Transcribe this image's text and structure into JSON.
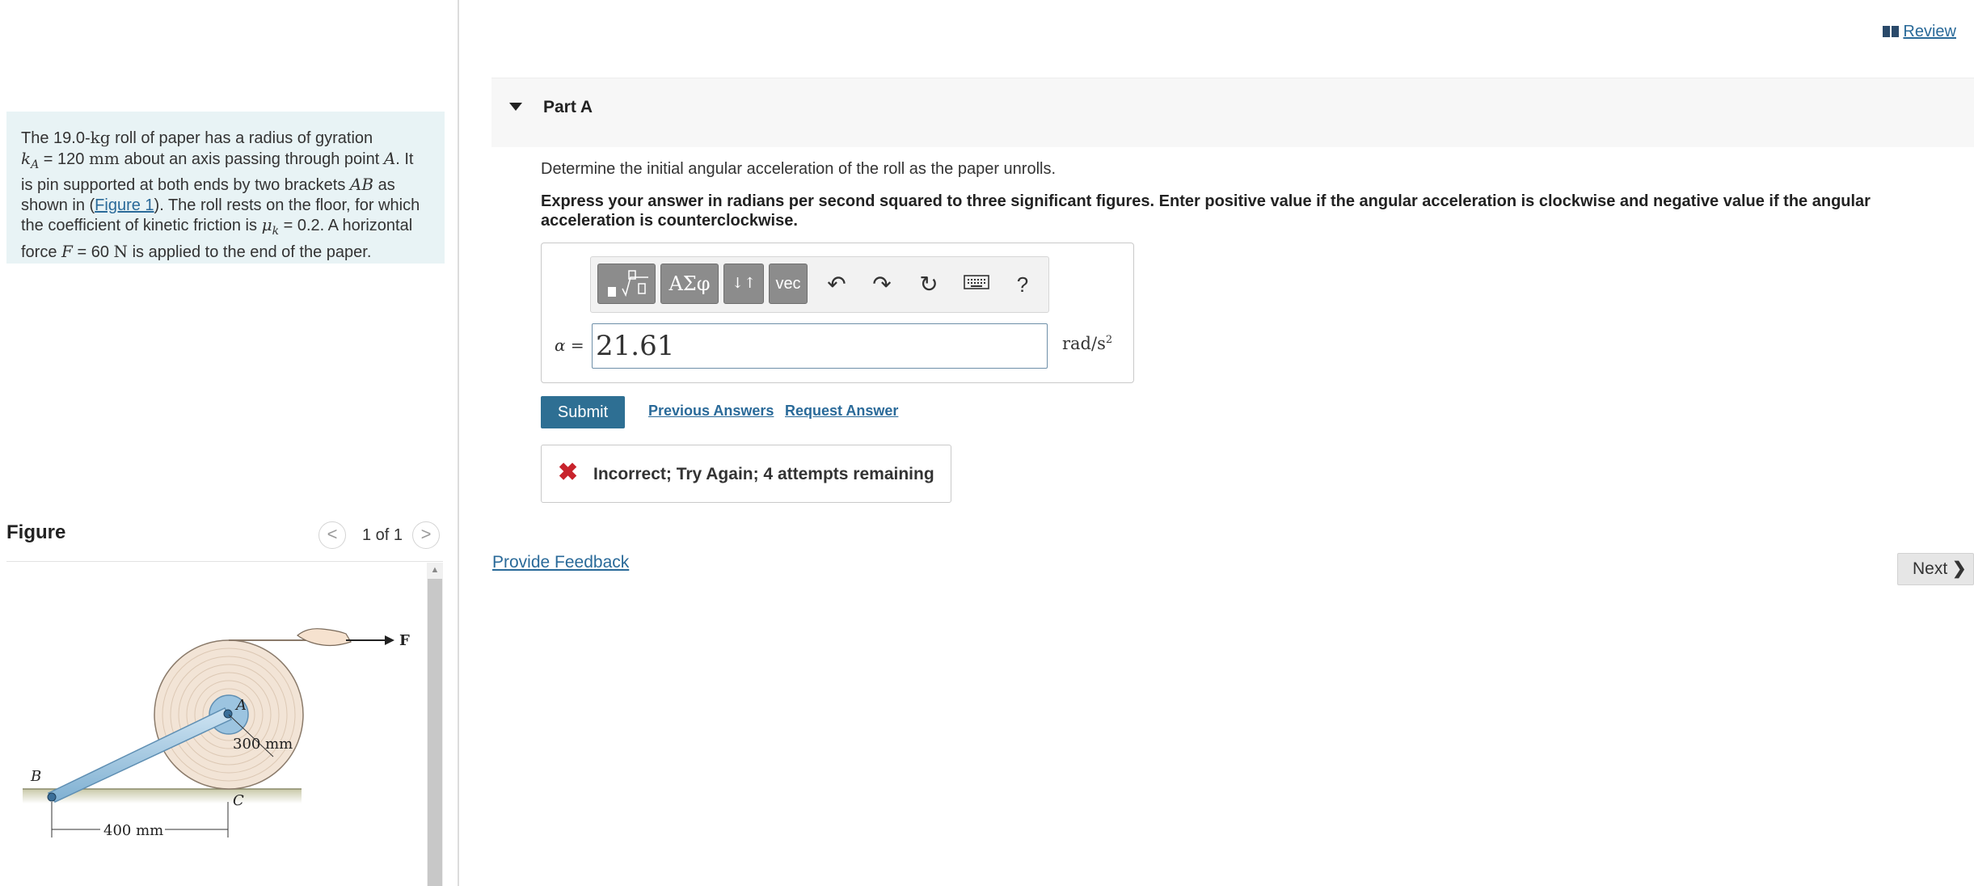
{
  "review": {
    "icon": "book-icon",
    "label": "Review"
  },
  "problem": {
    "line1_a": "The 19.0-",
    "line1_unit": "kg",
    "line1_b": " roll of paper has a radius of gyration",
    "kA_symbol": "k",
    "kA_sub": "A",
    "line2_a": " = 120 ",
    "line2_unit": "mm",
    "line2_b": " about an axis passing through point ",
    "pointA": "A",
    "line2_c": ". It",
    "line3_a": "is pin supported at both ends by two brackets ",
    "AB": "AB",
    "line3_b": " as",
    "line4_a": "shown in (",
    "figure_link": "Figure 1",
    "line4_b": "). The roll rests on the floor, for which",
    "line5_a": "the coefficient of kinetic friction is ",
    "mu_symbol": "μ",
    "mu_sub": "k",
    "line5_b": " = 0.2. A horizontal",
    "line6_a": "force ",
    "F_symbol": "F",
    "line6_b": " = 60 ",
    "line6_unit": "N",
    "line6_c": " is applied to the end of the paper."
  },
  "figure": {
    "title": "Figure",
    "counter": "1 of 1",
    "prev_glyph": "<",
    "next_glyph": ">",
    "labels": {
      "B": "B",
      "A": "A",
      "C": "C",
      "F": "F",
      "radius": "300 mm",
      "length": "400 mm"
    }
  },
  "part": {
    "title": "Part A",
    "caret": "caret-down-icon"
  },
  "question": "Determine the initial angular acceleration of the roll as the paper unrolls.",
  "instructions": "Express your answer in radians per second squared to three significant figures. Enter positive value if the angular acceleration is clockwise and negative value if the angular acceleration is counterclockwise.",
  "toolbar": {
    "greek_label": "ΑΣφ",
    "arrows_label": "↓↑",
    "vec_label": "vec",
    "help_label": "?"
  },
  "answer": {
    "variable": "α =",
    "value": "21.61",
    "units_base": "rad/s",
    "units_exp": "2"
  },
  "actions": {
    "submit": "Submit",
    "previous_answers": "Previous Answers",
    "request_answer": "Request Answer"
  },
  "feedback": {
    "icon": "x-icon",
    "message": "Incorrect; Try Again; 4 attempts remaining"
  },
  "footer": {
    "provide_feedback": "Provide Feedback",
    "next": "Next"
  },
  "colors": {
    "accent": "#2e6f93",
    "link": "#2a6a99",
    "error": "#c8232c",
    "problem_bg": "#e8f3f5"
  }
}
